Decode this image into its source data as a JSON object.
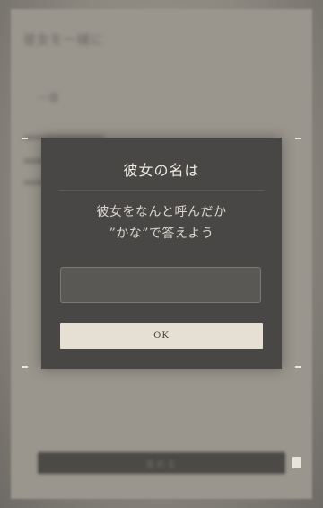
{
  "background": {
    "title": "彼女を一緒に",
    "subtitle": "一章",
    "button_label": "進める",
    "icons": {
      "page": "page-icon"
    }
  },
  "dialog": {
    "title": "彼女の名は",
    "prompt_lines": [
      "彼女をなんと呼んだか",
      "”かな”で答えよう"
    ],
    "input_value": "",
    "input_placeholder": "",
    "ok_label": "OK"
  },
  "colors": {
    "modal_bg": "#494745",
    "input_bg": "#5a5855",
    "ok_bg": "#e6e0d4",
    "text_light": "#efebe3"
  }
}
